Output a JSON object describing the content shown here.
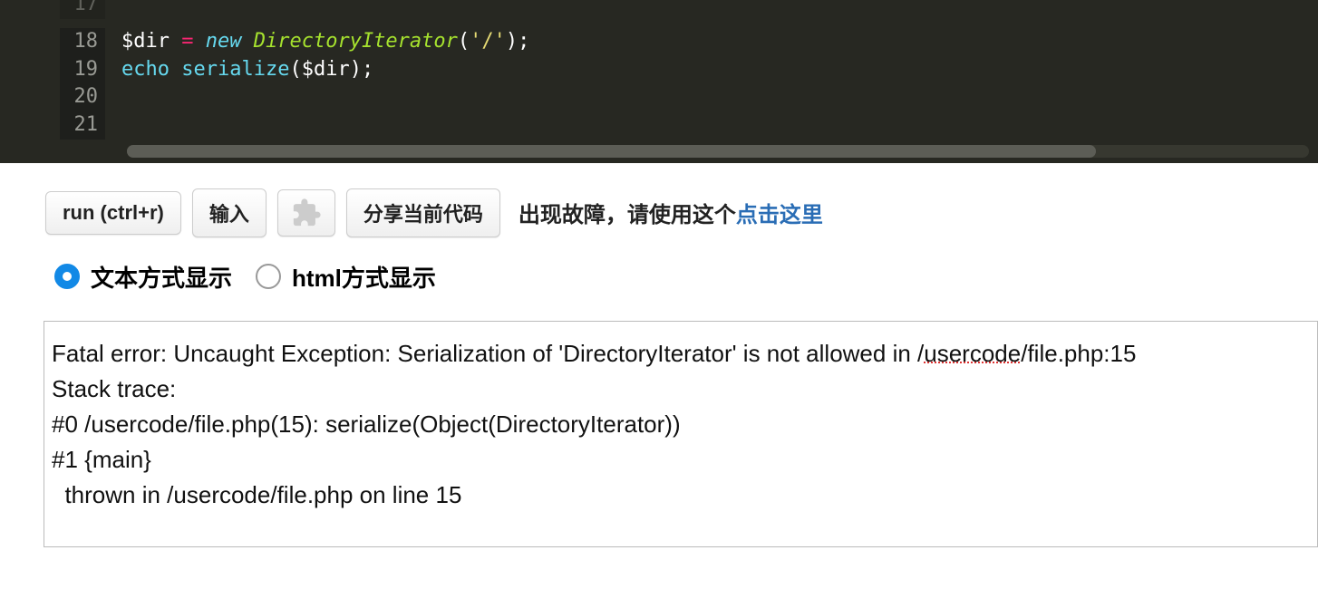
{
  "editor": {
    "lines": [
      {
        "num": "17",
        "tokens": [],
        "ghost": true
      },
      {
        "num": "18",
        "tokens": [
          {
            "t": "$dir",
            "c": "tok-var"
          },
          {
            "t": " ",
            "c": ""
          },
          {
            "t": "=",
            "c": "tok-op"
          },
          {
            "t": " ",
            "c": ""
          },
          {
            "t": "new",
            "c": "tok-new"
          },
          {
            "t": " ",
            "c": ""
          },
          {
            "t": "DirectoryIterator",
            "c": "tok-class"
          },
          {
            "t": "(",
            "c": "tok-paren"
          },
          {
            "t": "'/'",
            "c": "tok-str"
          },
          {
            "t": ")",
            "c": "tok-paren"
          },
          {
            "t": ";",
            "c": "tok-semi"
          }
        ]
      },
      {
        "num": "19",
        "tokens": [
          {
            "t": "echo",
            "c": "tok-echo"
          },
          {
            "t": " ",
            "c": ""
          },
          {
            "t": "serialize",
            "c": "tok-func"
          },
          {
            "t": "(",
            "c": "tok-paren"
          },
          {
            "t": "$dir",
            "c": "tok-var"
          },
          {
            "t": ")",
            "c": "tok-paren"
          },
          {
            "t": ";",
            "c": "tok-semi"
          }
        ]
      },
      {
        "num": "20",
        "tokens": []
      },
      {
        "num": "21",
        "tokens": []
      }
    ]
  },
  "toolbar": {
    "run_label": "run (ctrl+r)",
    "input_label": "输入",
    "share_label": "分享当前代码",
    "notice_prefix": "出现故障，请使用这个",
    "notice_link": "点击这里"
  },
  "display_mode": {
    "text_label": "文本方式显示",
    "html_label": "html方式显示",
    "selected": "text"
  },
  "output": {
    "line1_a": "Fatal error: Uncaught Exception: Serialization of 'DirectoryIterator' is not allowed in /",
    "line1_err": "usercode",
    "line1_b": "/file.php:15",
    "line2": "Stack trace:",
    "line3": "#0 /usercode/file.php(15): serialize(Object(DirectoryIterator))",
    "line4": "#1 {main}",
    "line5": "  thrown in /usercode/file.php on line 15"
  }
}
